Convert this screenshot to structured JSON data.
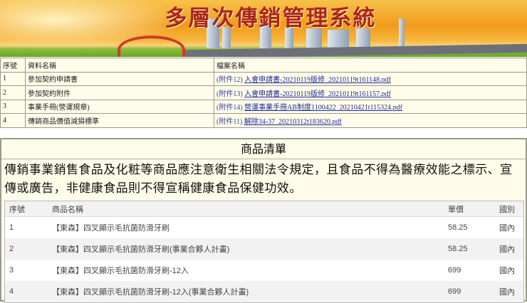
{
  "banner": {
    "title": "多層次傳銷管理系統"
  },
  "documents": {
    "headers": [
      "序號",
      "資料名稱",
      "檔案名稱"
    ],
    "rows": [
      {
        "no": "1",
        "name": "參加契約申請書",
        "attachment": "(附件12)",
        "file": "入會申請書-20210119版修_20210119t161148.pdf"
      },
      {
        "no": "2",
        "name": "參加契約附件",
        "attachment": "(附件13)",
        "file": "入會申請書-20210119版修_20210119t161157.pdf"
      },
      {
        "no": "3",
        "name": "事業手冊(營運規章)",
        "attachment": "(附件14)",
        "file": "營運事業手冊AB制度1100422_20210421t115324.pdf"
      },
      {
        "no": "4",
        "name": "傳銷商品價值減損標準",
        "attachment": "(附件11)",
        "file": "解除34-37_20210312t183620.pdf"
      }
    ]
  },
  "products": {
    "title": "商品清單",
    "notice": "傳銷事業銷售食品及化粧等商品應注意衛生相關法令規定，且食品不得為醫療效能之標示、宣傳或廣告，非健康食品則不得宣稱健康食品保健功效。",
    "headers": [
      "序號",
      "商品名稱",
      "單價",
      "國別"
    ],
    "rows": [
      {
        "no": "1",
        "name": "【東森】四叉顯示毛抗菌防滑牙刷",
        "price": "58.25",
        "country": "國內"
      },
      {
        "no": "2",
        "name": "【東森】四叉顯示毛抗菌防滑牙刷(事業合夥人計畫)",
        "price": "58.25",
        "country": "國內"
      },
      {
        "no": "3",
        "name": "【東森】四叉顯示毛抗菌防滑牙刷-12入",
        "price": "699",
        "country": "國內"
      },
      {
        "no": "4",
        "name": "【東森】四叉顯示毛抗菌防滑牙刷-12入(事業合夥人計畫)",
        "price": "699",
        "country": "國內"
      }
    ]
  }
}
